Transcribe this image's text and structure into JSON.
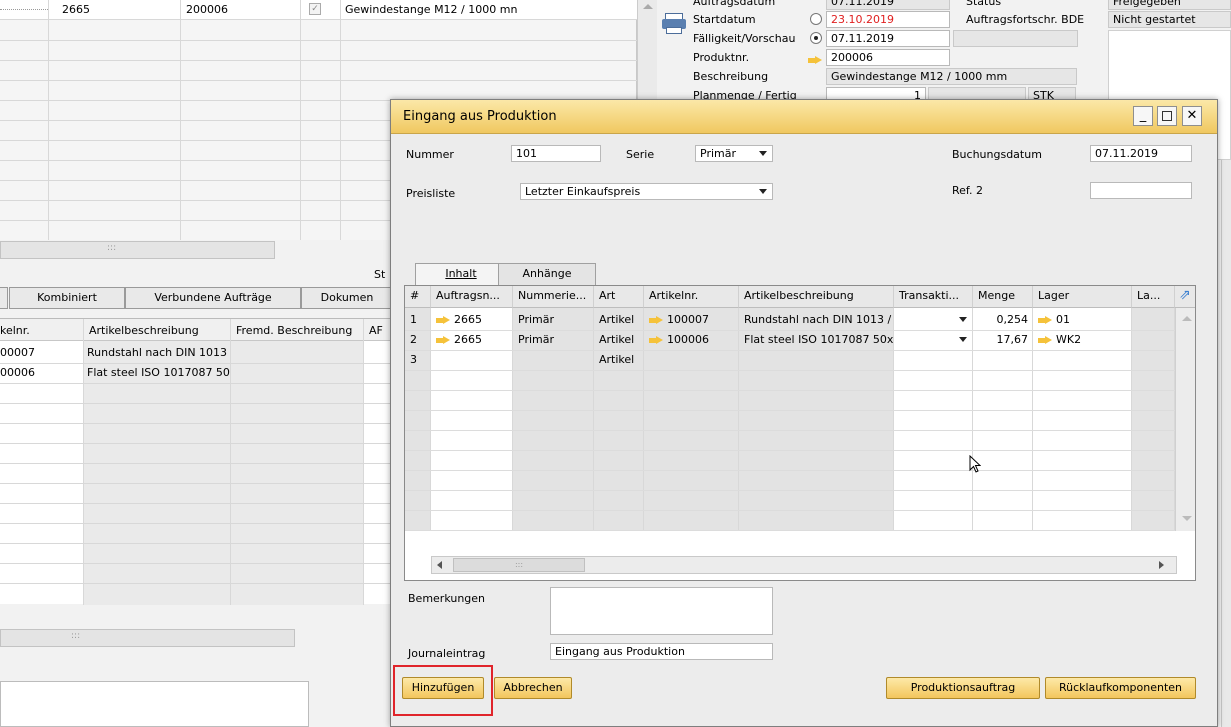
{
  "background": {
    "top_grid_row": {
      "doc_no": "2665",
      "product_no": "200006",
      "description": "Gewindestange M12 / 1000 mn"
    },
    "header": {
      "auftragsdatum_label": "Auftragsdatum",
      "auftragsdatum_value": "07.11.2019",
      "status_label": "Status",
      "status_value": "Freigegeben",
      "startdatum_label": "Startdatum",
      "startdatum_value": "23.10.2019",
      "bde_label": "Auftragsfortschr. BDE",
      "bde_value": "Nicht gestartet",
      "faelligkeit_label": "Fälligkeit/Vorschau",
      "faelligkeit_value": "07.11.2019",
      "produktnr_label": "Produktnr.",
      "produktnr_value": "200006",
      "beschreibung_label": "Beschreibung",
      "beschreibung_value": "Gewindestange M12 / 1000 mm",
      "planmenge_label": "Planmenge / Fertig",
      "planmenge_value": "1",
      "planmenge_unit": "STK"
    },
    "status_short": "St",
    "tabs": [
      "Kombiniert",
      "Verbundene Aufträge",
      "Dokumen"
    ],
    "grid_headers": [
      "kelnr.",
      "Artikelbeschreibung",
      "Fremd. Beschreibung",
      "AF"
    ],
    "grid_rows": [
      {
        "artikelnr": "00007",
        "beschreibung": "Rundstahl nach DIN 1013"
      },
      {
        "artikelnr": "00006",
        "beschreibung": "Flat steel ISO 1017087  50x"
      }
    ]
  },
  "dialog": {
    "title": "Eingang aus Produktion",
    "nummer_label": "Nummer",
    "nummer_value": "101",
    "serie_label": "Serie",
    "serie_value": "Primär",
    "buchungsdatum_label": "Buchungsdatum",
    "buchungsdatum_value": "07.11.2019",
    "preisliste_label": "Preisliste",
    "preisliste_value": "Letzter Einkaufspreis",
    "ref2_label": "Ref. 2",
    "ref2_value": "",
    "tabs": [
      "Inhalt",
      "Anhänge"
    ],
    "grid": {
      "headers": [
        "#",
        "Auftragsn...",
        "Nummerie...",
        "Art",
        "Artikelnr.",
        "Artikelbeschreibung",
        "Transakti...",
        "Menge",
        "Lager",
        "La..."
      ],
      "rows": [
        {
          "num": "1",
          "auftrag": "2665",
          "serie": "Primär",
          "art": "Artikel",
          "artikelnr": "100007",
          "beschreibung": "Rundstahl nach DIN 1013 /",
          "menge": "0,254",
          "lager": "01"
        },
        {
          "num": "2",
          "auftrag": "2665",
          "serie": "Primär",
          "art": "Artikel",
          "artikelnr": "100006",
          "beschreibung": "Flat steel ISO 1017087  50x",
          "menge": "17,67",
          "lager": "WK2"
        },
        {
          "num": "3",
          "auftrag": "",
          "serie": "",
          "art": "Artikel",
          "artikelnr": "",
          "beschreibung": "",
          "menge": "",
          "lager": ""
        }
      ]
    },
    "bemerkungen_label": "Bemerkungen",
    "bemerkungen_value": "",
    "journal_label": "Journaleintrag",
    "journal_value": "Eingang aus Produktion",
    "buttons": {
      "add": "Hinzufügen",
      "cancel": "Abbrechen",
      "prodauftrag": "Produktionsauftrag",
      "ruecklauf": "Rücklaufkomponenten"
    }
  }
}
